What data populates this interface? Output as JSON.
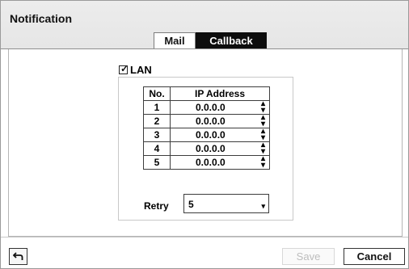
{
  "window": {
    "title": "Notification"
  },
  "tabs": [
    {
      "label": "Mail",
      "active": false
    },
    {
      "label": "Callback",
      "active": true
    }
  ],
  "lan": {
    "label": "LAN",
    "checked": true
  },
  "table": {
    "headers": {
      "no": "No.",
      "ip": "IP Address"
    },
    "rows": [
      {
        "no": "1",
        "ip": "0.0.0.0"
      },
      {
        "no": "2",
        "ip": "0.0.0.0"
      },
      {
        "no": "3",
        "ip": "0.0.0.0"
      },
      {
        "no": "4",
        "ip": "0.0.0.0"
      },
      {
        "no": "5",
        "ip": "0.0.0.0"
      }
    ]
  },
  "retry": {
    "label": "Retry",
    "value": "5"
  },
  "footer": {
    "save_label": "Save",
    "cancel_label": "Cancel"
  },
  "icons": {
    "back": "back-arrow-icon",
    "spin": "spinner-arrows-icon",
    "dropdown": "dropdown-caret-icon",
    "check": "checkmark-icon"
  },
  "colors": {
    "active_tab_bg": "#0d0d0d",
    "header_bg": "#ececec",
    "disabled_text": "#bdbdbd"
  }
}
